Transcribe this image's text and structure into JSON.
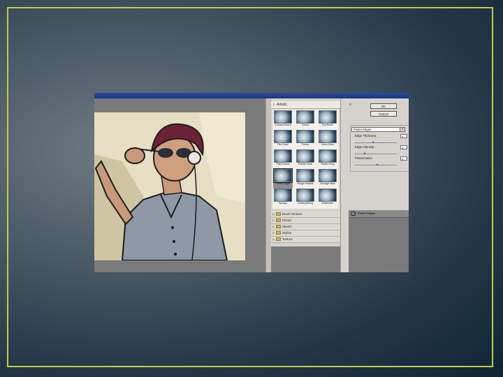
{
  "colors": {
    "frame_border": "#c8c84a",
    "title_bar": "#2b4c9c",
    "panel_gray": "#d6d3ce"
  },
  "gallery": {
    "category": "Artistic",
    "filters": [
      {
        "label": "Colored Pencil",
        "selected": false
      },
      {
        "label": "Cutout",
        "selected": false
      },
      {
        "label": "Dry Brush",
        "selected": false
      },
      {
        "label": "Film Grain",
        "selected": false
      },
      {
        "label": "Fresco",
        "selected": false
      },
      {
        "label": "Neon Glow",
        "selected": false
      },
      {
        "label": "Paint Daubs",
        "selected": false
      },
      {
        "label": "Palette Knife",
        "selected": false
      },
      {
        "label": "Plastic Wrap",
        "selected": false
      },
      {
        "label": "Poster Edges",
        "selected": true
      },
      {
        "label": "Rough Pastels",
        "selected": false
      },
      {
        "label": "Smudge Stick",
        "selected": false
      },
      {
        "label": "Sponge",
        "selected": false
      },
      {
        "label": "Underpainting",
        "selected": false
      },
      {
        "label": "Watercolor",
        "selected": false
      }
    ],
    "folders": [
      "Brush Strokes",
      "Distort",
      "Sketch",
      "Stylize",
      "Texture"
    ]
  },
  "controls": {
    "ok_label": "OK",
    "cancel_label": "Cancel",
    "filter_select": "Poster Edges",
    "params": [
      {
        "label": "Edge Thickness",
        "value": "4",
        "level": 0.4
      },
      {
        "label": "Edge Intensity",
        "value": "2",
        "level": 0.2
      },
      {
        "label": "Posterization",
        "value": "3",
        "level": 0.5
      }
    ]
  },
  "layers": {
    "effect_layer": "Poster Edges"
  }
}
